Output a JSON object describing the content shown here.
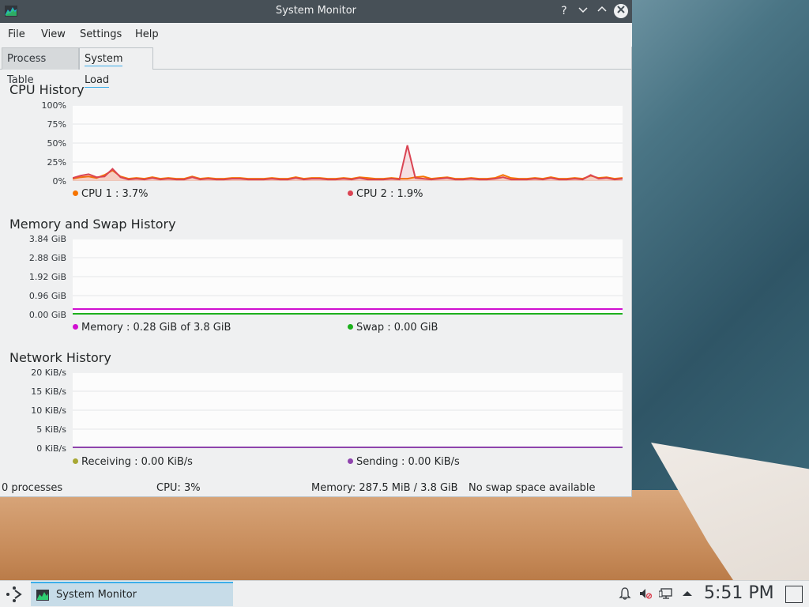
{
  "window": {
    "title": "System Monitor",
    "help_glyph": "?",
    "minimize_glyph": "⌄",
    "maximize_glyph": "⌃",
    "close_glyph": "✕"
  },
  "menu": {
    "file": "File",
    "view": "View",
    "settings": "Settings",
    "help": "Help"
  },
  "tabs": [
    {
      "label": "Process Table",
      "active": false
    },
    {
      "label": "System Load",
      "active": true
    }
  ],
  "cpu": {
    "title": "CPU History",
    "y_ticks": [
      "100%",
      "75%",
      "50%",
      "25%",
      "0%"
    ],
    "legend": [
      {
        "label": "CPU 1 : 3.7%",
        "color": "#f67400"
      },
      {
        "label": "CPU 2 : 1.9%",
        "color": "#da4453"
      }
    ]
  },
  "memory": {
    "title": "Memory and Swap History",
    "y_ticks": [
      "3.84 GiB",
      "2.88 GiB",
      "1.92 GiB",
      "0.96 GiB",
      "0.00 GiB"
    ],
    "legend": [
      {
        "label": "Memory : 0.28 GiB of 3.8 GiB",
        "color": "#d10fd1"
      },
      {
        "label": "Swap : 0.00 GiB",
        "color": "#1cb01c"
      }
    ]
  },
  "network": {
    "title": "Network History",
    "y_ticks": [
      "20 KiB/s",
      "15 KiB/s",
      "10 KiB/s",
      "5 KiB/s",
      "0 KiB/s"
    ],
    "legend": [
      {
        "label": "Receiving : 0.00 KiB/s",
        "color": "#a7a733"
      },
      {
        "label": "Sending : 0.00 KiB/s",
        "color": "#8e44ad"
      }
    ]
  },
  "status": {
    "processes": "0 processes",
    "cpu": "CPU: 3%",
    "memory": "Memory: 287.5 MiB / 3.8 GiB",
    "swap": "No swap space available"
  },
  "taskbar": {
    "task_label": "System Monitor",
    "clock": "5:51 PM"
  },
  "icons": {
    "app": "system-monitor-icon",
    "launcher": "application-launcher-icon",
    "notifications": "bell-icon",
    "volume": "volume-muted-icon",
    "network": "network-icon",
    "tray_expand": "arrow-up-icon",
    "show_desktop": "show-desktop-icon"
  },
  "chart_data": [
    {
      "type": "line",
      "title": "CPU History",
      "ylim": [
        0,
        100
      ],
      "y_unit": "%",
      "series": [
        {
          "name": "CPU 1",
          "color": "#f67400",
          "values": [
            3,
            5,
            6,
            4,
            8,
            14,
            6,
            3,
            4,
            3,
            5,
            3,
            4,
            3,
            3,
            6,
            3,
            4,
            3,
            3,
            4,
            4,
            3,
            3,
            3,
            4,
            3,
            3,
            5,
            3,
            4,
            4,
            3,
            3,
            4,
            3,
            5,
            4,
            3,
            3,
            4,
            3,
            3,
            5,
            6,
            3,
            4,
            5,
            3,
            3,
            4,
            3,
            3,
            4,
            8,
            4,
            3,
            3,
            4,
            3,
            5,
            3,
            3,
            4,
            3,
            7,
            4,
            5,
            3,
            4
          ]
        },
        {
          "name": "CPU 2",
          "color": "#da4453",
          "values": [
            4,
            7,
            9,
            5,
            6,
            16,
            5,
            2,
            3,
            2,
            4,
            2,
            3,
            2,
            2,
            5,
            2,
            3,
            2,
            2,
            3,
            3,
            2,
            2,
            2,
            3,
            2,
            2,
            4,
            2,
            3,
            3,
            2,
            2,
            3,
            2,
            4,
            2,
            2,
            2,
            3,
            2,
            47,
            4,
            3,
            2,
            3,
            4,
            2,
            2,
            3,
            2,
            2,
            3,
            5,
            2,
            2,
            2,
            3,
            2,
            4,
            2,
            2,
            3,
            2,
            8,
            3,
            4,
            2,
            3
          ]
        }
      ]
    },
    {
      "type": "line",
      "title": "Memory and Swap History",
      "ylim": [
        0,
        3.84
      ],
      "y_unit": "GiB",
      "series": [
        {
          "name": "Memory",
          "color": "#d10fd1",
          "values": [
            0.28,
            0.28
          ]
        },
        {
          "name": "Swap",
          "color": "#1cb01c",
          "values": [
            0.0,
            0.0
          ]
        }
      ]
    },
    {
      "type": "line",
      "title": "Network History",
      "ylim": [
        0,
        20
      ],
      "y_unit": "KiB/s",
      "series": [
        {
          "name": "Receiving",
          "color": "#a7a733",
          "values": [
            0,
            0
          ]
        },
        {
          "name": "Sending",
          "color": "#8e44ad",
          "values": [
            0,
            0
          ]
        }
      ]
    }
  ]
}
